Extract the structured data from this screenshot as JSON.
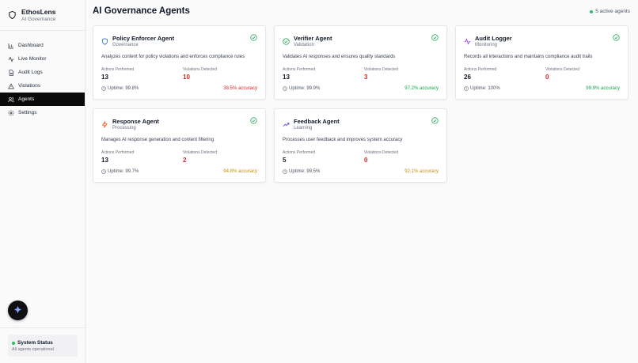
{
  "brand": {
    "name": "EthosLens",
    "subtitle": "AI Governance"
  },
  "nav": [
    {
      "label": "Dashboard",
      "icon": "chart-icon"
    },
    {
      "label": "Live Monitor",
      "icon": "activity-icon"
    },
    {
      "label": "Audit Logs",
      "icon": "file-icon"
    },
    {
      "label": "Violations",
      "icon": "warning-icon"
    },
    {
      "label": "Agents",
      "icon": "users-icon",
      "active": true
    },
    {
      "label": "Settings",
      "icon": "gear-icon"
    }
  ],
  "system_status": {
    "title": "System Status",
    "subtitle": "All agents operational"
  },
  "page": {
    "title": "AI Governance Agents",
    "active_count": "5 active agents"
  },
  "labels": {
    "actions": "Actions Performed",
    "violations": "Violations Detected"
  },
  "colors": {
    "accent": "#0a0a0a",
    "green": "#16a34a",
    "red": "#dc2626",
    "amber": "#ca8a04"
  },
  "agents": [
    {
      "name": "Policy Enforcer Agent",
      "role": "Governance",
      "icon": "shield-icon",
      "description": "Analyzes content for policy violations and enforces compliance rules",
      "actions": "13",
      "violations": "10",
      "uptime": "Uptime: 99.8%",
      "accuracy": "38.5% accuracy",
      "accuracy_color": "#dc2626"
    },
    {
      "name": "Verifier Agent",
      "role": "Validation",
      "icon": "check-circle-icon",
      "description": "Validates AI responses and ensures quality standards",
      "actions": "13",
      "violations": "3",
      "uptime": "Uptime: 99.9%",
      "accuracy": "97.2% accuracy",
      "accuracy_color": "#16a34a"
    },
    {
      "name": "Audit Logger",
      "role": "Monitoring",
      "icon": "activity-icon",
      "description": "Records all interactions and maintains compliance audit trails",
      "actions": "26",
      "violations": "0",
      "uptime": "Uptime: 100%",
      "accuracy": "99.9% accuracy",
      "accuracy_color": "#16a34a"
    },
    {
      "name": "Response Agent",
      "role": "Processing",
      "icon": "zap-icon",
      "description": "Manages AI response generation and content filtering",
      "actions": "13",
      "violations": "2",
      "uptime": "Uptime: 99.7%",
      "accuracy": "94.8% accuracy",
      "accuracy_color": "#ca8a04"
    },
    {
      "name": "Feedback Agent",
      "role": "Learning",
      "icon": "trending-up-icon",
      "description": "Processes user feedback and improves system accuracy",
      "actions": "5",
      "violations": "0",
      "uptime": "Uptime: 99.5%",
      "accuracy": "92.1% accuracy",
      "accuracy_color": "#ca8a04"
    }
  ]
}
